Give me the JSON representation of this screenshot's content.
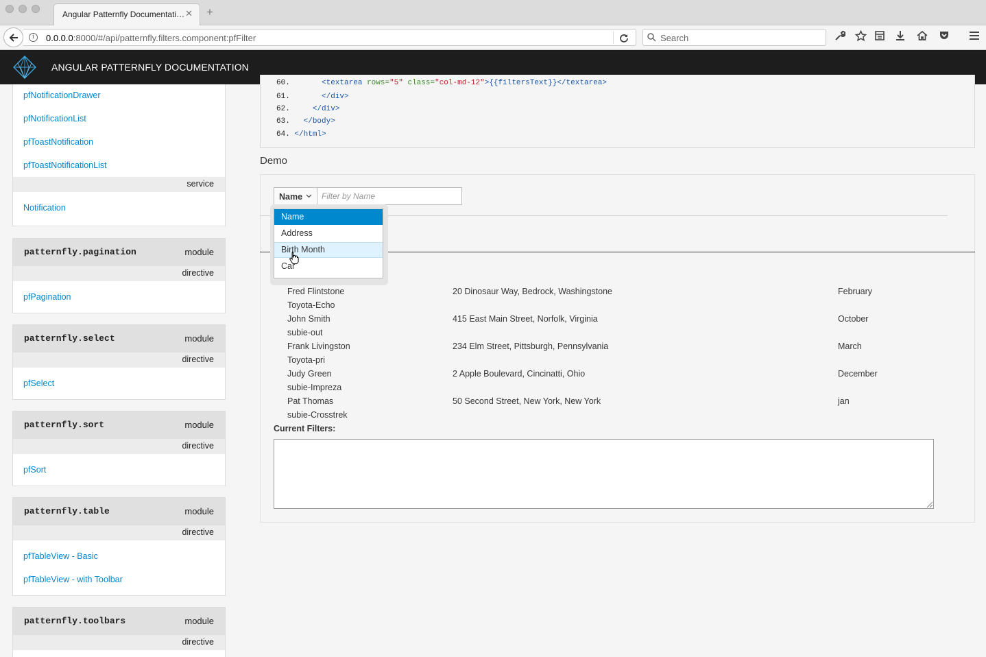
{
  "browser": {
    "tab_title": "Angular Patternfly Documentati…",
    "tab_close": "✕",
    "new_tab": "+",
    "url_host": "0.0.0.0",
    "url_rest": ":8000/#/api/patternfly.filters.component:pfFilter",
    "search_placeholder": "Search"
  },
  "app": {
    "title": "ANGULAR PATTERNFLY DOCUMENTATION",
    "brand_color": "#1d1d1d",
    "accent_color": "#0088ce"
  },
  "sidebar": {
    "top_links": [
      "pfNotificationDrawer",
      "pfNotificationList",
      "pfToastNotification",
      "pfToastNotificationList"
    ],
    "service_label": "service",
    "service_link": "Notification",
    "modules": [
      {
        "name": "patternfly.pagination",
        "kind": "module",
        "sub": "directive",
        "links": [
          "pfPagination"
        ]
      },
      {
        "name": "patternfly.select",
        "kind": "module",
        "sub": "directive",
        "links": [
          "pfSelect"
        ]
      },
      {
        "name": "patternfly.sort",
        "kind": "module",
        "sub": "directive",
        "links": [
          "pfSort"
        ]
      },
      {
        "name": "patternfly.table",
        "kind": "module",
        "sub": "directive",
        "links": [
          "pfTableView - Basic",
          "pfTableView - with Toolbar"
        ]
      },
      {
        "name": "patternfly.toolbars",
        "kind": "module",
        "sub": "directive",
        "links": []
      }
    ]
  },
  "code": {
    "lines": [
      {
        "num": "60.",
        "indent": "      ",
        "tag_open": "<textarea",
        "attr1": " rows=",
        "val1": "\"5\"",
        "attr2": " class=",
        "val2": "\"col-md-12\"",
        "rest": ">{{filtersText}}</textarea>"
      },
      {
        "num": "61.",
        "indent": "      ",
        "text": "</div>"
      },
      {
        "num": "62.",
        "indent": "    ",
        "text": "</div>"
      },
      {
        "num": "63.",
        "indent": "  ",
        "text": "</body>"
      },
      {
        "num": "64.",
        "indent": "",
        "text": "</html>"
      }
    ]
  },
  "demo": {
    "title": "Demo",
    "filter_select_label": "Name",
    "filter_input_placeholder": "Filter by Name",
    "dropdown_options": [
      "Name",
      "Address",
      "Birth Month",
      "Car"
    ],
    "dropdown_selected": "Name",
    "dropdown_hovered": "Birth Month",
    "rows": [
      {
        "name": "Fred Flintstone",
        "address": "20 Dinosaur Way, Bedrock, Washingstone",
        "month": "February",
        "car": "Toyota-Echo"
      },
      {
        "name": "John Smith",
        "address": "415 East Main Street, Norfolk, Virginia",
        "month": "October",
        "car": "subie-out"
      },
      {
        "name": "Frank Livingston",
        "address": "234 Elm Street, Pittsburgh, Pennsylvania",
        "month": "March",
        "car": "Toyota-pri"
      },
      {
        "name": "Judy Green",
        "address": "2 Apple Boulevard, Cincinatti, Ohio",
        "month": "December",
        "car": "subie-Impreza"
      },
      {
        "name": "Pat Thomas",
        "address": "50 Second Street, New York, New York",
        "month": "jan",
        "car": "subie-Crosstrek"
      }
    ],
    "current_filters_label": "Current Filters:",
    "current_filters_value": ""
  }
}
